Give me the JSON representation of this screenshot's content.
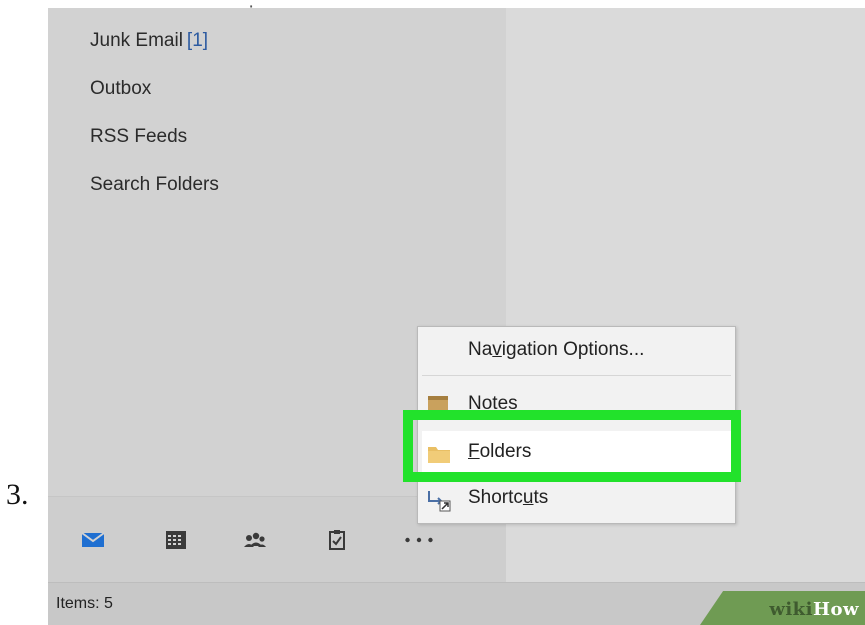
{
  "step": {
    "number": "3."
  },
  "folders": {
    "items": [
      {
        "name": "Junk Email",
        "count": "[1]"
      },
      {
        "name": "Outbox",
        "count": ""
      },
      {
        "name": "RSS Feeds",
        "count": ""
      },
      {
        "name": "Search Folders",
        "count": ""
      }
    ]
  },
  "nav": {
    "icons": [
      "mail-icon",
      "calendar-icon",
      "people-icon",
      "tasks-icon",
      "more-icon"
    ]
  },
  "menu": {
    "navigation_options": {
      "pre": "Na",
      "key": "v",
      "post": "igation Options..."
    },
    "notes": {
      "label": "Notes"
    },
    "folders": {
      "pre": "",
      "key": "F",
      "post": "olders"
    },
    "shortcuts": {
      "pre": "Shortc",
      "key": "u",
      "post": "ts"
    }
  },
  "status": {
    "items": "Items: 5"
  },
  "watermark": {
    "wiki": "wiki",
    "how": "How"
  },
  "colors": {
    "highlight": "#22e22b",
    "mail_icon": "#1f6fd1",
    "count_text": "#2c5aa0",
    "watermark_bg": "#6f9b53"
  }
}
